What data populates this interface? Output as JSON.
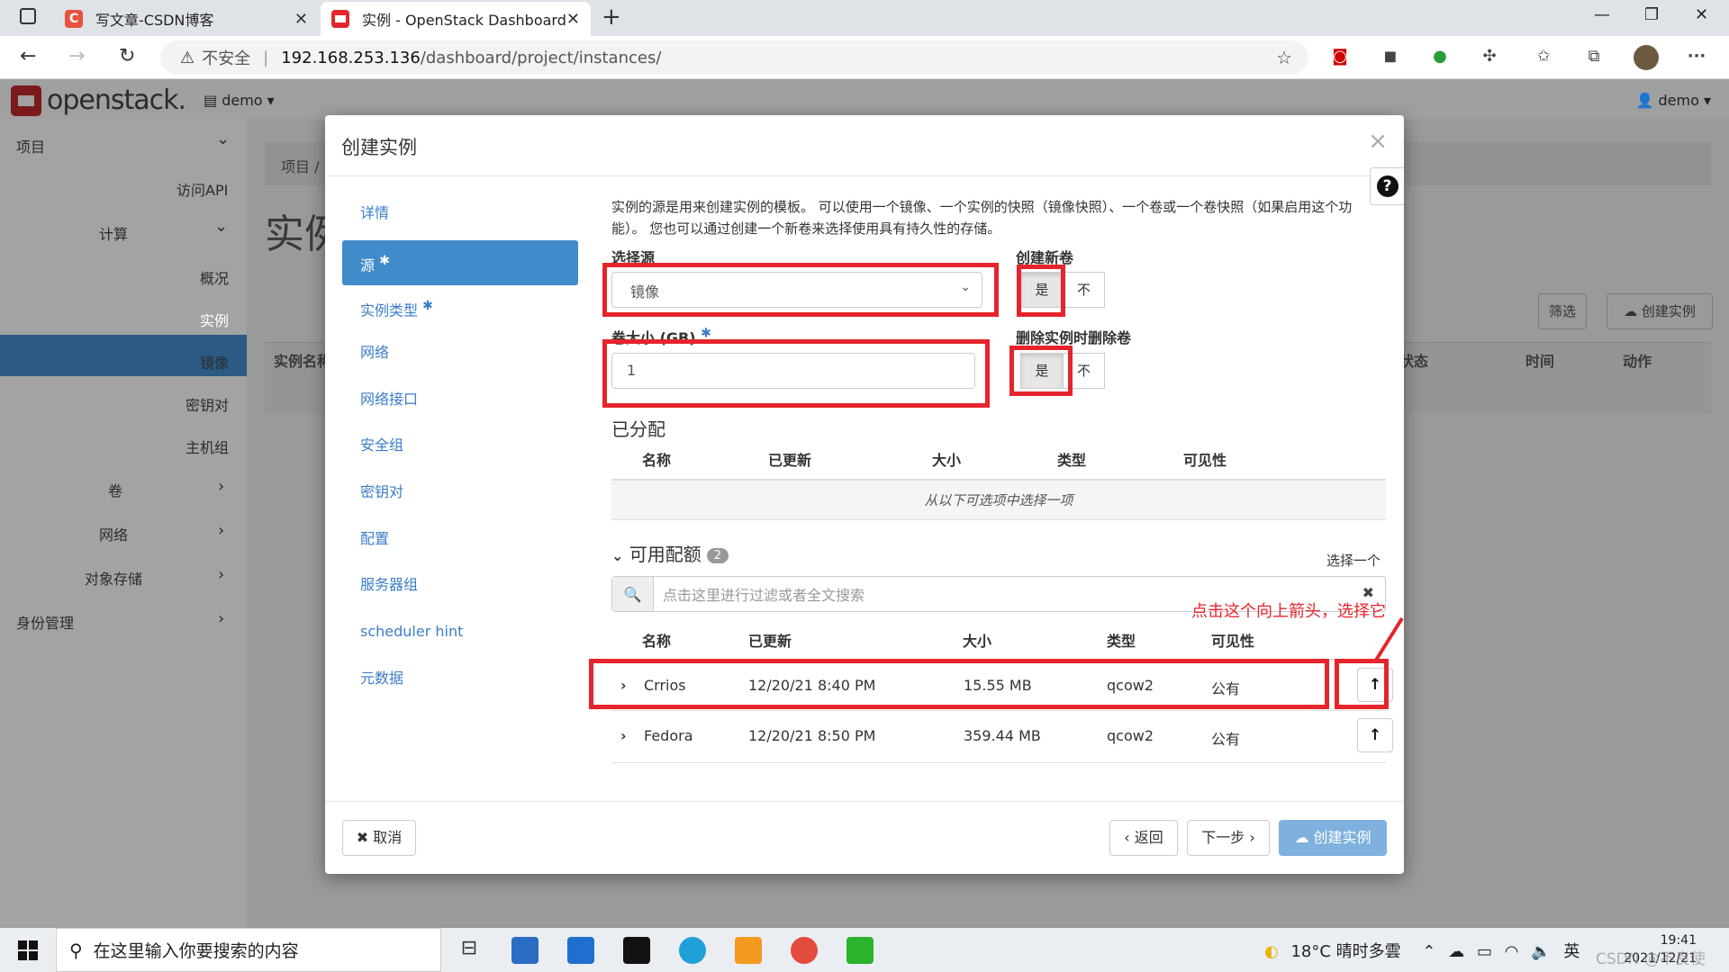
{
  "browser": {
    "tabs": [
      {
        "title": "写文章-CSDN博客",
        "close": "✕"
      },
      {
        "title": "实例 - OpenStack Dashboard",
        "close": "✕"
      }
    ],
    "new_tab": "+",
    "security": "不安全",
    "url_host": "192.168.253.136",
    "url_path": "/dashboard/project/instances/",
    "minimize": "—",
    "maximize": "❐",
    "close": "✕",
    "more": "···"
  },
  "openstack": {
    "logo": "openstack.",
    "project_menu": "demo",
    "user_menu": "demo",
    "sidebar": [
      {
        "label": "项目",
        "indent": 0,
        "chev": "⌄"
      },
      {
        "label": "访问API",
        "indent": 2
      },
      {
        "label": "计算",
        "indent": 1,
        "chev": "⌄"
      },
      {
        "label": "概况",
        "indent": 2
      },
      {
        "label": "实例",
        "indent": 2
      },
      {
        "label": "镜像",
        "indent": 2
      },
      {
        "label": "密钥对",
        "indent": 2
      },
      {
        "label": "主机组",
        "indent": 2
      },
      {
        "label": "卷",
        "indent": 1,
        "chev": "›"
      },
      {
        "label": "网络",
        "indent": 1,
        "chev": "›"
      },
      {
        "label": "对象存储",
        "indent": 1,
        "chev": "›"
      },
      {
        "label": "身份管理",
        "indent": 0,
        "chev": "›"
      }
    ],
    "background": {
      "breadcrumb": "项目 /",
      "page_title": "实例",
      "filter_btn": "筛选",
      "create_btn": "创建实例",
      "col_name": "实例名称",
      "col_status": "状态",
      "col_time": "时间",
      "col_action": "动作"
    }
  },
  "modal": {
    "title": "创建实例",
    "close": "×",
    "help": "?",
    "steps": [
      {
        "label": "详情",
        "required": false
      },
      {
        "label": "源",
        "required": true
      },
      {
        "label": "实例类型",
        "required": true
      },
      {
        "label": "网络",
        "required": false
      },
      {
        "label": "网络接口",
        "required": false
      },
      {
        "label": "安全组",
        "required": false
      },
      {
        "label": "密钥对",
        "required": false
      },
      {
        "label": "配置",
        "required": false
      },
      {
        "label": "服务器组",
        "required": false
      },
      {
        "label": "scheduler hint",
        "required": false
      },
      {
        "label": "元数据",
        "required": false
      }
    ],
    "description": "实例的源是用来创建实例的模板。 可以使用一个镜像、一个实例的快照（镜像快照）、一个卷或一个卷快照（如果启用这个功能）。 您也可以通过创建一个新卷来选择使用具有持久性的存储。",
    "select_source_label": "选择源",
    "select_source_value": "镜像",
    "volume_size_label": "卷大小 (GB)",
    "volume_size_value": "1",
    "create_volume_label": "创建新卷",
    "delete_volume_label": "删除实例时删除卷",
    "yes": "是",
    "no": "不",
    "allocated": {
      "title": "已分配",
      "headers": [
        "名称",
        "已更新",
        "大小",
        "类型",
        "可见性"
      ],
      "empty": "从以下可选项中选择一项"
    },
    "available": {
      "title": "可用配额",
      "count": "2",
      "select_one": "选择一个",
      "filter_placeholder": "点击这里进行过滤或者全文搜索",
      "clear": "✖",
      "headers": [
        "名称",
        "已更新",
        "大小",
        "类型",
        "可见性"
      ],
      "rows": [
        {
          "name": "Crrios",
          "updated": "12/20/21 8:40 PM",
          "size": "15.55 MB",
          "type": "qcow2",
          "visibility": "公有"
        },
        {
          "name": "Fedora",
          "updated": "12/20/21 8:50 PM",
          "size": "359.44 MB",
          "type": "qcow2",
          "visibility": "公有"
        }
      ]
    },
    "annotation": "点击这个向上箭头，选择它",
    "footer": {
      "cancel": "✖ 取消",
      "back": "‹ 返回",
      "next": "下一步 ›",
      "create": "创建实例"
    }
  },
  "taskbar": {
    "search_placeholder": "在这里输入你要搜索的内容",
    "weather": "18°C  晴时多雲",
    "ime": "英",
    "time": "19:41",
    "date": "2021/12/21",
    "watermark": "CSDN @不良使"
  }
}
